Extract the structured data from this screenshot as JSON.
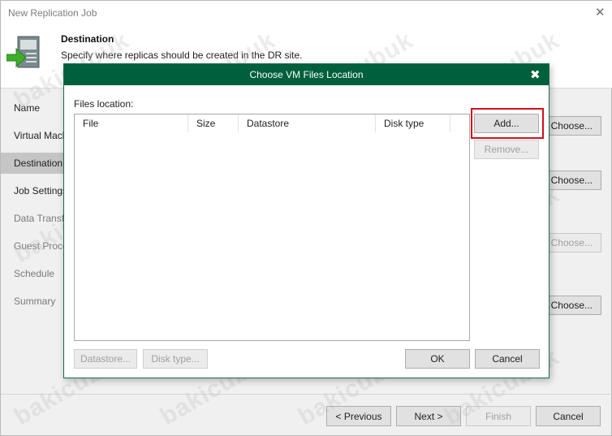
{
  "window": {
    "title": "New Replication Job",
    "close_glyph": "✕"
  },
  "header": {
    "title": "Destination",
    "subtitle": "Specify where replicas should be created in the DR site.",
    "icon": "replication-server-icon"
  },
  "nav": {
    "items": [
      {
        "label": "Name",
        "state": "normal"
      },
      {
        "label": "Virtual Machines",
        "state": "normal"
      },
      {
        "label": "Destination",
        "state": "active"
      },
      {
        "label": "Job Settings",
        "state": "normal"
      },
      {
        "label": "Data Transfer",
        "state": "dim"
      },
      {
        "label": "Guest Processing",
        "state": "dim"
      },
      {
        "label": "Schedule",
        "state": "dim"
      },
      {
        "label": "Summary",
        "state": "dim"
      }
    ]
  },
  "choose_buttons": [
    {
      "label": "Choose...",
      "enabled": true
    },
    {
      "label": "Choose...",
      "enabled": true
    },
    {
      "label": "Choose...",
      "enabled": false
    },
    {
      "label": "Choose...",
      "enabled": true
    }
  ],
  "footer": {
    "previous": "< Previous",
    "next": "Next >",
    "finish": "Finish",
    "cancel": "Cancel"
  },
  "dialog": {
    "title": "Choose VM Files Location",
    "close_glyph": "✖",
    "files_label": "Files location:",
    "columns": [
      "File",
      "Size",
      "Datastore",
      "Disk type"
    ],
    "rows": [],
    "add_label": "Add...",
    "remove_label": "Remove...",
    "datastore_label": "Datastore...",
    "disktype_label": "Disk type...",
    "ok_label": "OK",
    "cancel_label": "Cancel",
    "highlight_color": "#d0111b"
  },
  "watermark": "bakicubuk",
  "colors": {
    "dialog_titlebar": "#005f3c",
    "nav_active": "#c5c5c5"
  }
}
